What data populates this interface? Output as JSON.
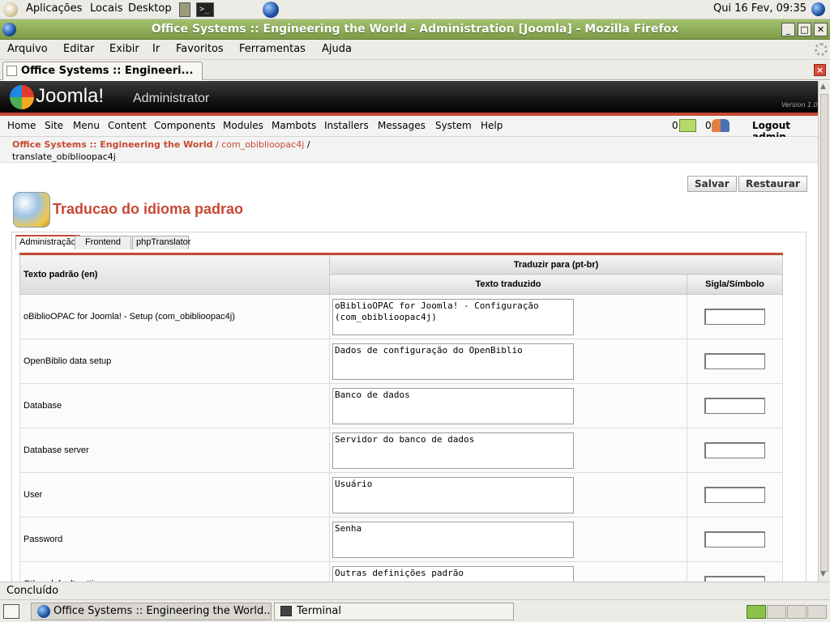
{
  "desktop": {
    "menu_apps": "Aplicações",
    "menu_places": "Locais",
    "menu_desktop": "Desktop",
    "clock": "Qui 16 Fev, 09:35"
  },
  "window": {
    "title": "Office Systems :: Engineering the World - Administration [Joomla] - Mozilla Firefox"
  },
  "firefox_menu": {
    "file": "Arquivo",
    "edit": "Editar",
    "view": "Exibir",
    "go": "Ir",
    "bookmarks": "Favoritos",
    "tools": "Ferramentas",
    "help": "Ajuda"
  },
  "tab": {
    "label": "Office Systems :: Engineeri..."
  },
  "joomla": {
    "logo_text": "Joomla!",
    "admin_label": "Administrator",
    "version": "Version 1.0"
  },
  "nav": {
    "home": "Home",
    "site": "Site",
    "menu": "Menu",
    "content": "Content",
    "components": "Components",
    "modules": "Modules",
    "mambots": "Mambots",
    "installers": "Installers",
    "messages": "Messages",
    "system": "System",
    "help": "Help",
    "msg_count": "0",
    "users_count": "0",
    "logout": "Logout admin"
  },
  "breadcrumb": {
    "site": "Office Systems :: Engineering the World",
    "sep1": "/",
    "component": "com_obiblioopac4j",
    "sep2": "/",
    "page": "translate_obiblioopac4j"
  },
  "toolbar": {
    "save": "Salvar",
    "restore": "Restaurar"
  },
  "page": {
    "title": "Traducao do idioma padrao"
  },
  "tabs": [
    "Administração",
    "Frontend",
    "phpTranslator"
  ],
  "table": {
    "col_default": "Texto padrão (en)",
    "col_translate": "Traduzir para (pt-br)",
    "col_translated": "Texto traduzido",
    "col_symbol": "Sigla/Símbolo",
    "rows": [
      {
        "default": "oBiblioOPAC for Joomla! - Setup (com_obiblioopac4j)",
        "translated": "oBiblioOPAC for Joomla! - Configuração (com_obiblioopac4j)"
      },
      {
        "default": "OpenBiblio data setup",
        "translated": "Dados de configuração do OpenBiblio"
      },
      {
        "default": "Database",
        "translated": "Banco de dados"
      },
      {
        "default": "Database server",
        "translated": "Servidor do banco de dados"
      },
      {
        "default": "User",
        "translated": "Usuário"
      },
      {
        "default": "Password",
        "translated": "Senha"
      },
      {
        "default": "Other default settings",
        "translated": "Outras definições padrão"
      }
    ]
  },
  "status": {
    "text": "Concluído"
  },
  "taskbar": {
    "firefox": "Office Systems :: Engineering the World...",
    "terminal": "Terminal"
  }
}
